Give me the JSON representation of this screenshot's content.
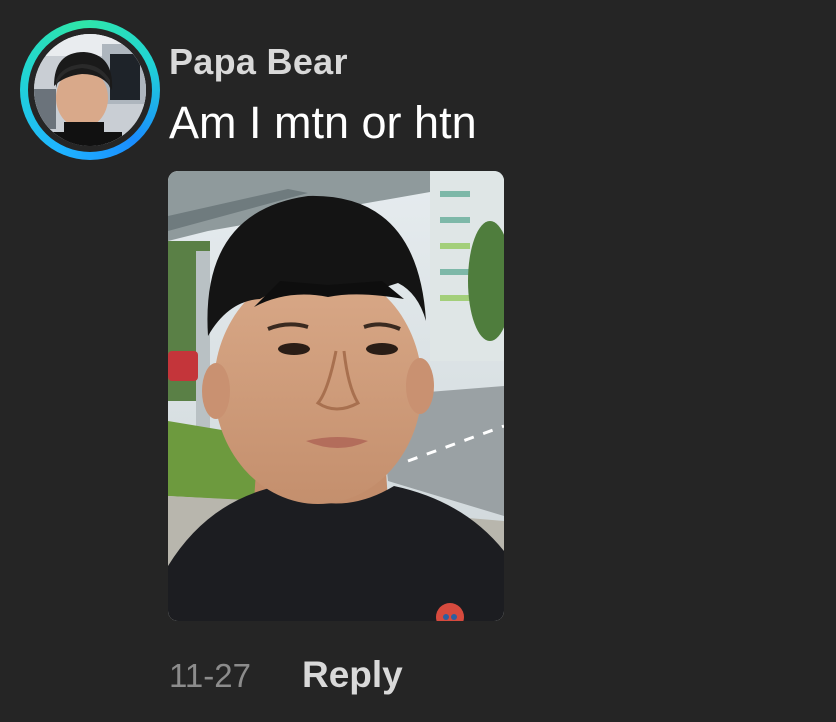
{
  "comment": {
    "username": "Papa Bear",
    "text": "Am I mtn or htn",
    "date": "11-27",
    "reply_label": "Reply",
    "avatar_icon": "user-avatar-photo",
    "photo_icon": "attached-selfie-photo"
  },
  "colors": {
    "background": "#252525",
    "username": "#d9d9d9",
    "text": "#ffffff",
    "date": "#8c8c8c",
    "avatar_ring_start": "#1fb6ff",
    "avatar_ring_end": "#2fe6a8"
  }
}
